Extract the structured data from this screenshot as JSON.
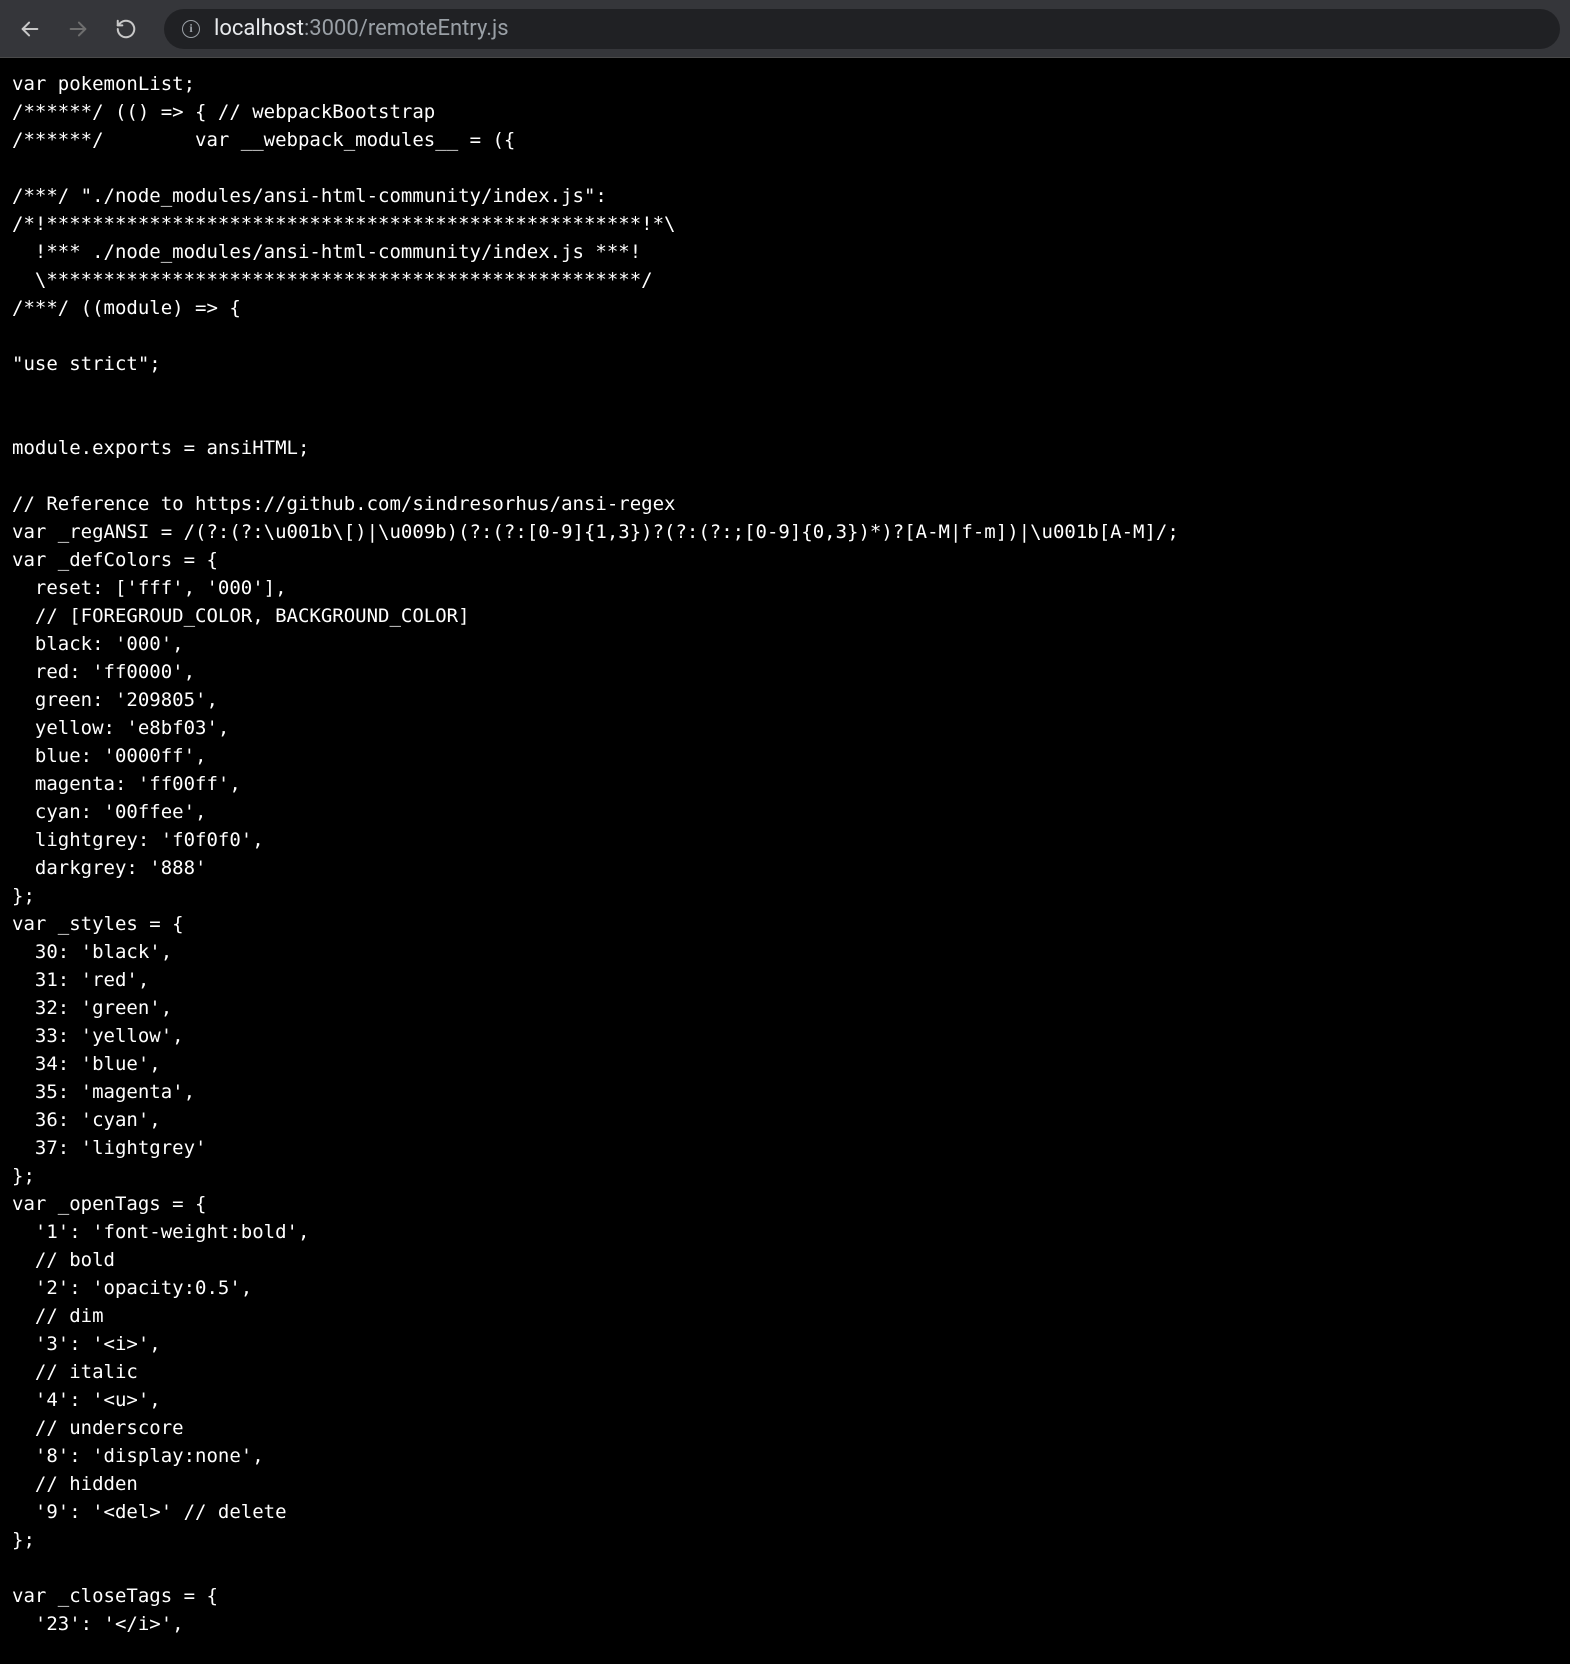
{
  "address_bar": {
    "host": "localhost",
    "port": ":3000",
    "path": "/remoteEntry.js"
  },
  "code_lines": [
    "var pokemonList;",
    "/******/ (() => { // webpackBootstrap",
    "/******/ \tvar __webpack_modules__ = ({",
    "",
    "/***/ \"./node_modules/ansi-html-community/index.js\":",
    "/*!****************************************************!*\\",
    "  !*** ./node_modules/ansi-html-community/index.js ***!",
    "  \\****************************************************/",
    "/***/ ((module) => {",
    "",
    "\"use strict\";",
    "",
    "",
    "module.exports = ansiHTML;",
    "",
    "// Reference to https://github.com/sindresorhus/ansi-regex",
    "var _regANSI = /(?:(?:\\u001b\\[)|\\u009b)(?:(?:[0-9]{1,3})?(?:(?:;[0-9]{0,3})*)?[A-M|f-m])|\\u001b[A-M]/;",
    "var _defColors = {",
    "  reset: ['fff', '000'],",
    "  // [FOREGROUD_COLOR, BACKGROUND_COLOR]",
    "  black: '000',",
    "  red: 'ff0000',",
    "  green: '209805',",
    "  yellow: 'e8bf03',",
    "  blue: '0000ff',",
    "  magenta: 'ff00ff',",
    "  cyan: '00ffee',",
    "  lightgrey: 'f0f0f0',",
    "  darkgrey: '888'",
    "};",
    "var _styles = {",
    "  30: 'black',",
    "  31: 'red',",
    "  32: 'green',",
    "  33: 'yellow',",
    "  34: 'blue',",
    "  35: 'magenta',",
    "  36: 'cyan',",
    "  37: 'lightgrey'",
    "};",
    "var _openTags = {",
    "  '1': 'font-weight:bold',",
    "  // bold",
    "  '2': 'opacity:0.5',",
    "  // dim",
    "  '3': '<i>',",
    "  // italic",
    "  '4': '<u>',",
    "  // underscore",
    "  '8': 'display:none',",
    "  // hidden",
    "  '9': '<del>' // delete",
    "};",
    "",
    "var _closeTags = {",
    "  '23': '</i>',"
  ]
}
